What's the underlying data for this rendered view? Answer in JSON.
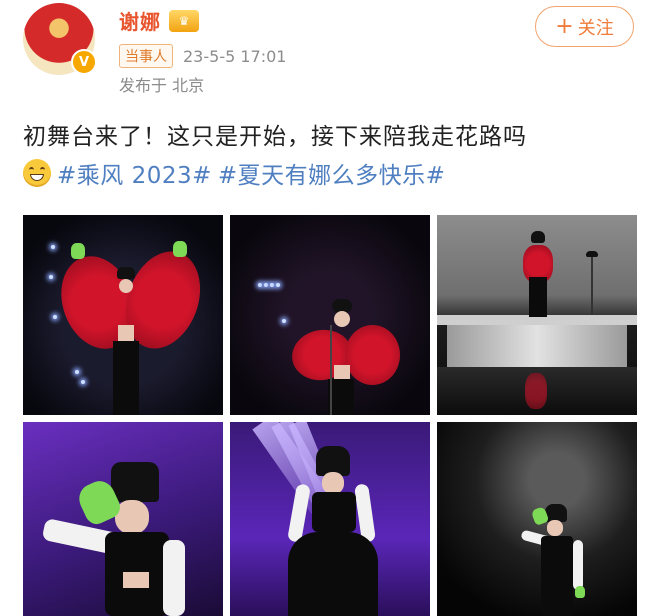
{
  "header": {
    "username": "谢娜",
    "vip_icon": "vip-crown-icon",
    "verified_icon": "verified-v-icon",
    "badge": "当事人",
    "timestamp": "23-5-5 17:01",
    "location": "发布于 北京",
    "follow_label": "关注",
    "follow_plus": "+"
  },
  "post": {
    "text": "初舞台来了！这只是开始，接下来陪我走花路吗",
    "emoji": "grinning-face-emoji",
    "topics": [
      "#乘风 2023#",
      "#夏天有娜么多快乐#"
    ]
  },
  "photos": [
    {
      "name": "photo-1",
      "alt": "stage-red-feather-wings"
    },
    {
      "name": "photo-2",
      "alt": "stage-red-feather-mic"
    },
    {
      "name": "photo-3",
      "alt": "stage-platform-gray"
    },
    {
      "name": "photo-4",
      "alt": "stage-purple-green-glove"
    },
    {
      "name": "photo-5",
      "alt": "stage-purple-beams-dance"
    },
    {
      "name": "photo-6",
      "alt": "stage-dark-pose"
    }
  ],
  "colors": {
    "username": "#e8552f",
    "topic": "#4f7fc0",
    "follow_border": "#f2a46e",
    "badge_text": "#e07b2a"
  }
}
